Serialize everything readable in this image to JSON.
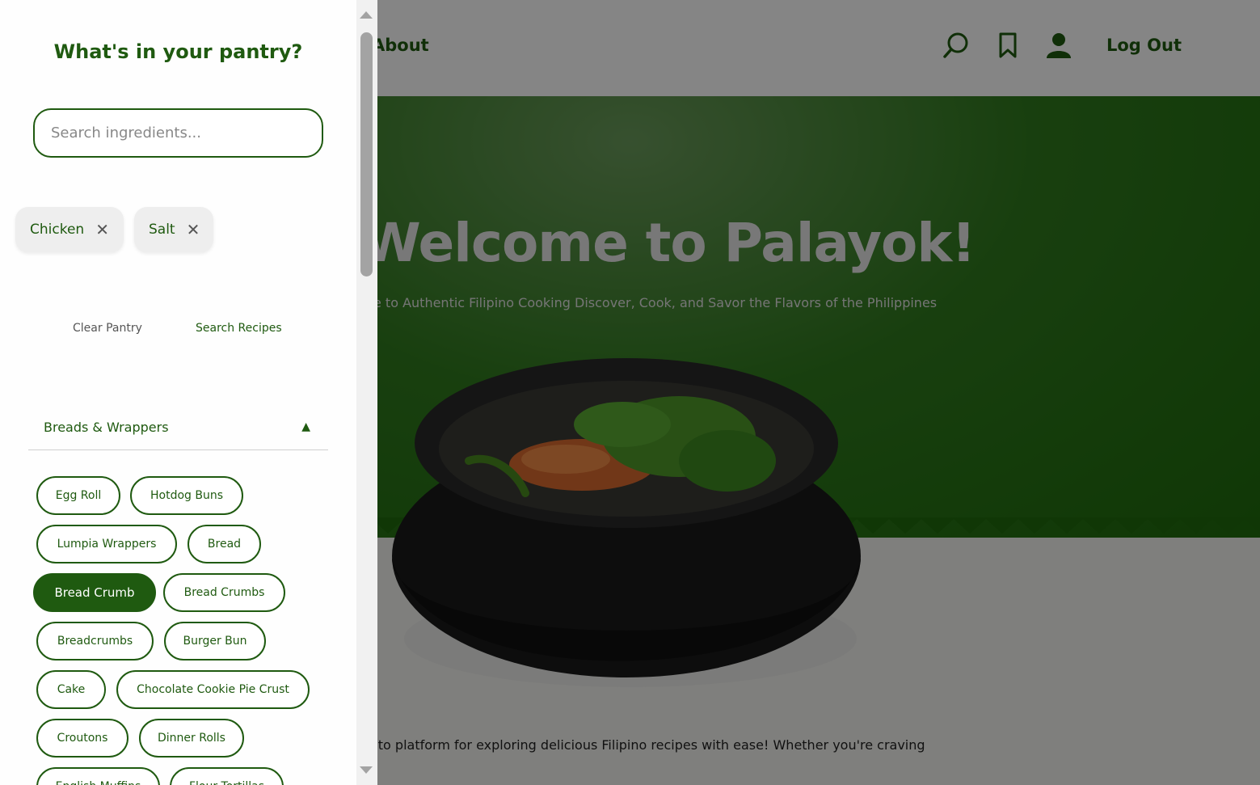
{
  "site": {
    "nav": {
      "about_label": "About",
      "search_icon": "search-icon",
      "bookmark_icon": "bookmark-icon",
      "user_icon": "user-icon",
      "logout_label": "Log Out"
    },
    "hero": {
      "title": "Welcome to Palayok!",
      "subtitle": "e to Authentic Filipino Cooking Discover, Cook, and Savor the Flavors of the Philippines"
    },
    "body_text": "-to platform for exploring delicious Filipino recipes with ease! Whether you're craving"
  },
  "pantry": {
    "title": "What's in your pantry?",
    "search_placeholder": "Search ingredients...",
    "selected": [
      {
        "label": "Chicken"
      },
      {
        "label": "Salt"
      }
    ],
    "clear_label": "Clear Pantry",
    "search_label": "Search Recipes",
    "category": {
      "label": "Breads & Wrappers",
      "expanded": true,
      "items": [
        {
          "label": "Egg Roll"
        },
        {
          "label": "Hotdog Buns"
        },
        {
          "label": "Lumpia Wrappers"
        },
        {
          "label": "Bread"
        },
        {
          "label": "Bread Crumb",
          "active": true
        },
        {
          "label": "Bread Crumbs"
        },
        {
          "label": "Breadcrumbs"
        },
        {
          "label": "Burger Bun"
        },
        {
          "label": "Cake"
        },
        {
          "label": "Chocolate Cookie Pie Crust"
        },
        {
          "label": "Croutons"
        },
        {
          "label": "Dinner Rolls"
        },
        {
          "label": "English Muffins"
        },
        {
          "label": "Flour Tortillas"
        }
      ]
    }
  },
  "colors": {
    "brand_green": "#1f5a10",
    "hero_green": "#2f7a1d"
  }
}
